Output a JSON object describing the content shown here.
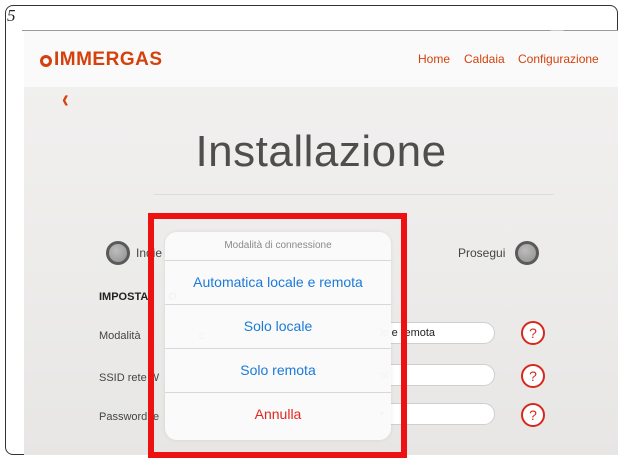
{
  "figure_label": "5",
  "brand": {
    "name": "IMMERGAS"
  },
  "nav": {
    "items": [
      "Home",
      "Caldaia",
      "Configurazione"
    ]
  },
  "page": {
    "title": "Installazione",
    "back_symbol": "‹"
  },
  "actions": {
    "back_label": "Indie",
    "next_label": "Prosegui"
  },
  "settings": {
    "section_label": "IMPOSTA",
    "section_label_suffix": "O",
    "rows": [
      {
        "label": "Modalità",
        "label_tail": "c",
        "value": "le e remota"
      },
      {
        "label": "SSID rete",
        "label_tail": "W",
        "value": "st"
      },
      {
        "label": "Password",
        "label_tail": "re",
        "value": "•"
      }
    ],
    "help_symbol": "?"
  },
  "action_sheet": {
    "title": "Modalità di connessione",
    "options": [
      "Automatica locale e remota",
      "Solo locale",
      "Solo remota"
    ],
    "cancel": "Annulla"
  },
  "colors": {
    "brand": "#d4410c",
    "link": "#1b7ad8",
    "cancel": "#e0281f",
    "highlight": "#ee1111"
  },
  "icons": [
    "back-chevron-icon",
    "help-icon",
    "radio-circle-icon"
  ]
}
